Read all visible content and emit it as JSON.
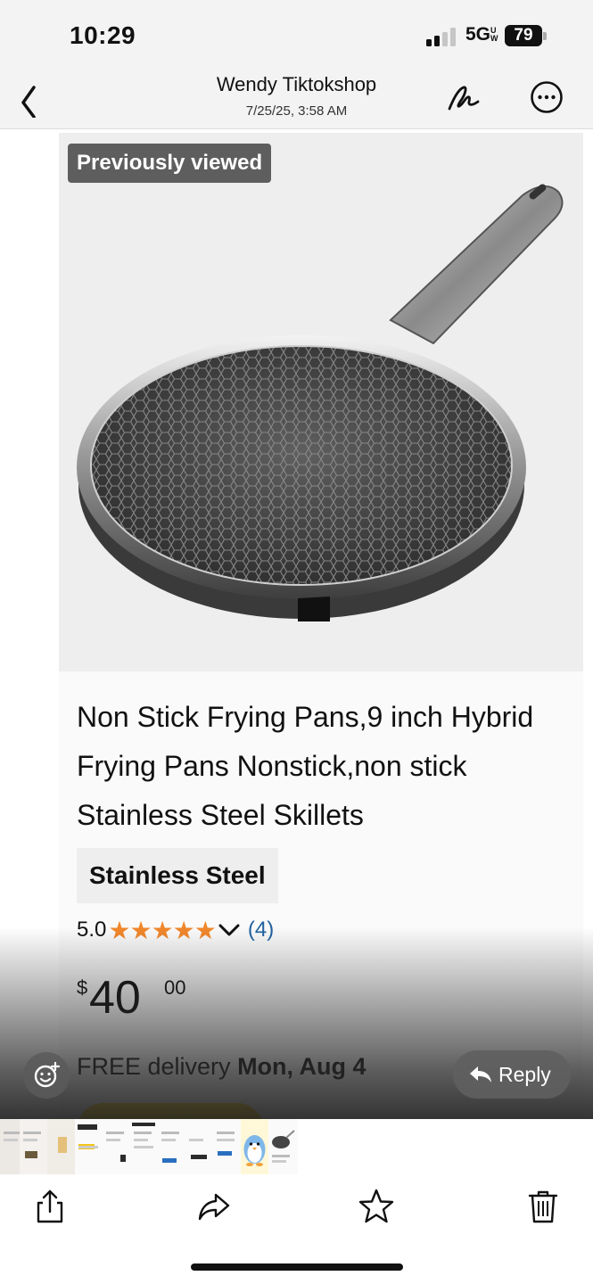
{
  "status_bar": {
    "time": "10:29",
    "network": "5G",
    "network_suffix": "UW",
    "battery": "79"
  },
  "header": {
    "title": "Wendy Tiktokshop",
    "subtitle": "7/25/25, 3:58 AM"
  },
  "product": {
    "badge": "Previously viewed",
    "title": "Non Stick Frying Pans,9 inch Hybrid Frying Pans Nonstick,non stick Stainless Steel Skillets",
    "variant": "Stainless Steel",
    "rating": "5.0",
    "stars": "★★★★★",
    "review_count": "(4)",
    "price_currency": "$",
    "price_whole": "40",
    "price_fraction": "00",
    "delivery_prefix": "FREE delivery ",
    "delivery_date": "Mon, Aug 4"
  },
  "actions": {
    "reply_label": "Reply"
  },
  "icons": {
    "back": "chevron-left-icon",
    "signature": "signature-icon",
    "more": "ellipsis-circle-icon",
    "emoji": "emoji-add-icon",
    "reply": "reply-arrow-icon",
    "share": "share-icon",
    "forward": "forward-icon",
    "star": "star-icon",
    "trash": "trash-icon"
  },
  "colors": {
    "star": "#f1872b",
    "review_link": "#2162a1",
    "cart_button": "#f7d22c"
  }
}
